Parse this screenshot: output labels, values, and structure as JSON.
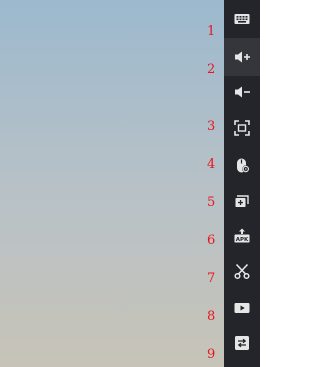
{
  "toolbar": {
    "items": [
      {
        "number": "1",
        "icon": "keyboard-icon"
      },
      {
        "number": "2",
        "icon": "volume-up-icon",
        "active": true
      },
      {
        "number": "3",
        "icon": "volume-down-icon"
      },
      {
        "number": "4",
        "icon": "screenshot-icon"
      },
      {
        "number": "5",
        "icon": "mouse-settings-icon"
      },
      {
        "number": "6",
        "icon": "add-window-icon"
      },
      {
        "number": "7",
        "icon": "install-apk-icon"
      },
      {
        "number": "8",
        "icon": "scissors-icon"
      },
      {
        "number": "9",
        "icon": "video-record-icon"
      },
      {
        "number": "",
        "icon": "settings-sliders-icon"
      }
    ]
  },
  "labels": {
    "n1": "1",
    "n2": "2",
    "n3": "3",
    "n4": "4",
    "n5": "5",
    "n6": "6",
    "n7": "7",
    "n8": "8",
    "n9": "9"
  },
  "colors": {
    "label": "#e8161d",
    "toolbar_bg": "#24252b",
    "icon": "#e6e6e6"
  }
}
